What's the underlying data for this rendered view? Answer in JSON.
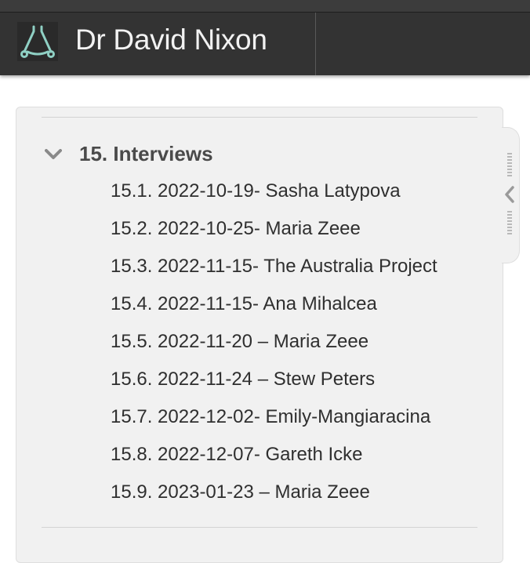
{
  "header": {
    "site_title": "Dr David Nixon",
    "logo_icon": "stethoscope-icon"
  },
  "colors": {
    "header_bg": "#333333",
    "panel_bg": "#f1f1f1",
    "logo_accent": "#8fd0c4"
  },
  "toc": {
    "section_title": "15. Interviews",
    "collapse_icon": "chevron-down-icon",
    "items": [
      "15.1. 2022-10-19- Sasha Latypova",
      "15.2. 2022-10-25- Maria Zeee",
      "15.3. 2022-11-15- The Australia Project",
      "15.4. 2022-11-15- Ana Mihalcea",
      "15.5. 2022-11-20 – Maria Zeee",
      "15.6. 2022-11-24 – Stew Peters",
      "15.7. 2022-12-02- Emily-Mangiaracina",
      "15.8. 2022-12-07- Gareth Icke",
      "15.9. 2023-01-23 – Maria Zeee"
    ]
  },
  "side_tab": {
    "toggle_icon": "chevron-left-icon"
  }
}
